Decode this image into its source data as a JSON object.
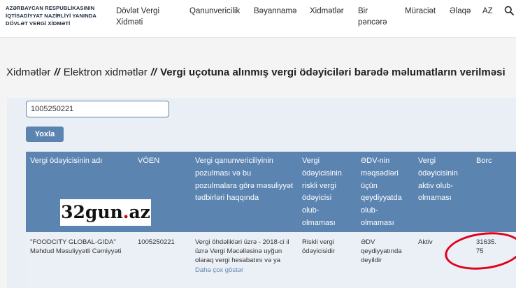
{
  "header": {
    "logo_lines": [
      "AZƏRBAYCAN RESPUBLİKASININ",
      "İQTİSADİYYAT NAZİRLİYİ YANINDA",
      "DÖVLƏT VERGİ XİDMƏTİ"
    ],
    "nav": [
      {
        "line1": "Dövlət Vergi",
        "line2": "Xidməti"
      },
      {
        "line1": "Qanunvericilik",
        "line2": ""
      },
      {
        "line1": "Bəyannamə",
        "line2": ""
      },
      {
        "line1": "Xidmətlər",
        "line2": ""
      },
      {
        "line1": "Bir",
        "line2": "pəncərə"
      },
      {
        "line1": "Müraciət",
        "line2": ""
      },
      {
        "line1": "Əlaqə",
        "line2": ""
      },
      {
        "line1": "AZ",
        "line2": ""
      }
    ],
    "search_icon": "search-icon"
  },
  "breadcrumb": {
    "item1": "Xidmətlər",
    "item2": "Elektron xidmətlər",
    "current": "Vergi uçotuna alınmış vergi ödəyiciləri barədə məlumatların verilməsi",
    "separator": "//"
  },
  "form": {
    "voen_value": "1005250221",
    "submit_label": "Yoxla"
  },
  "table": {
    "headers": [
      "Vergi ödəyicisinin adı",
      "VÖEN",
      "Vergi qanunvericiliyinin pozulması və bu pozulmalara görə məsuliyyət tədbirləri haqqında",
      "Vergi ödəyicisinin riskli vergi ödəyicisi olub-olmaması",
      "ƏDV-nin məqsədləri üçün qeydiyyatda olub-olmaması",
      "Vergi ödəyicisinin aktiv olub-olmaması",
      "Borc"
    ],
    "row": {
      "name": "\"FOODCITY GLOBAL-GIDA\" Məhdud Məsuliyyətli Cəmiyyəti",
      "voen": "1005250221",
      "violations": "Vergi öhdəlikləri üzrə - 2018-ci il üzrə Vergi Məcəlləsinə uyğun olaraq vergi hesabatını və ya",
      "more_link": "Daha çox göstər",
      "risky": "Riskli vergi ödəyicisidir",
      "vat": "ƏDV qeydiyyatında deyildir",
      "active": "Aktiv",
      "debt": "31635.75"
    }
  },
  "watermark": {
    "text": "32gun",
    "dot": ".",
    "suffix": "az"
  },
  "colors": {
    "accent": "#5b84b1",
    "highlight": "#e3001b",
    "panel": "#e9eff5"
  }
}
